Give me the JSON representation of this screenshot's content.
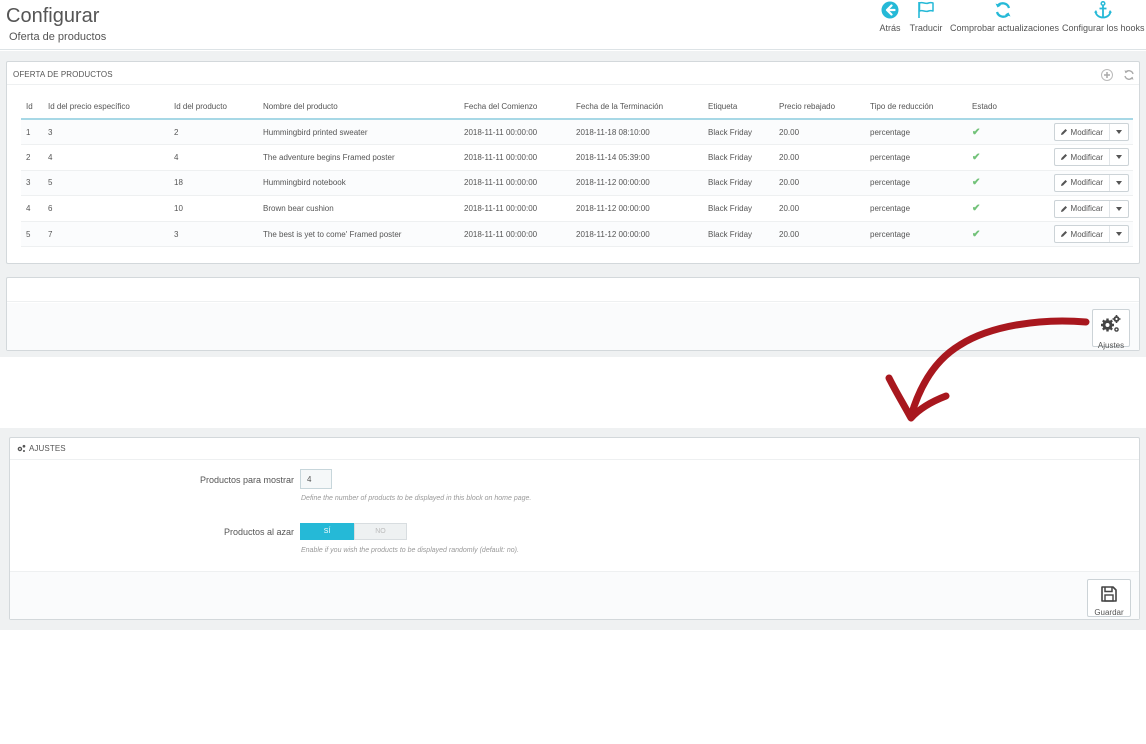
{
  "header": {
    "title": "Configurar",
    "subtitle": "Oferta de productos",
    "toolbar": [
      {
        "label": "Atrás",
        "icon": "arrow-left-circle-icon"
      },
      {
        "label": "Traducir",
        "icon": "flag-icon"
      },
      {
        "label": "Comprobar actualizaciones",
        "icon": "refresh-icon"
      },
      {
        "label": "Configurar los hooks",
        "icon": "anchor-icon"
      }
    ]
  },
  "offers_panel": {
    "title": "OFERTA DE PRODUCTOS",
    "columns": [
      "Id",
      "Id del precio específico",
      "Id del producto",
      "Nombre del producto",
      "Fecha del Comienzo",
      "Fecha de la Terminación",
      "Etiqueta",
      "Precio rebajado",
      "Tipo de reducción",
      "Estado"
    ],
    "rows": [
      {
        "id": "1",
        "price_id": "3",
        "product_id": "2",
        "name": "Hummingbird printed sweater",
        "start": "2018-11-11 00:00:00",
        "end": "2018-11-18 08:10:00",
        "label": "Black Friday",
        "price": "20.00",
        "type": "percentage"
      },
      {
        "id": "2",
        "price_id": "4",
        "product_id": "4",
        "name": "The adventure begins Framed poster",
        "start": "2018-11-11 00:00:00",
        "end": "2018-11-14 05:39:00",
        "label": "Black Friday",
        "price": "20.00",
        "type": "percentage"
      },
      {
        "id": "3",
        "price_id": "5",
        "product_id": "18",
        "name": "Hummingbird notebook",
        "start": "2018-11-11 00:00:00",
        "end": "2018-11-12 00:00:00",
        "label": "Black Friday",
        "price": "20.00",
        "type": "percentage"
      },
      {
        "id": "4",
        "price_id": "6",
        "product_id": "10",
        "name": "Brown bear cushion",
        "start": "2018-11-11 00:00:00",
        "end": "2018-11-12 00:00:00",
        "label": "Black Friday",
        "price": "20.00",
        "type": "percentage"
      },
      {
        "id": "5",
        "price_id": "7",
        "product_id": "3",
        "name": "The best is yet to come' Framed poster",
        "start": "2018-11-11 00:00:00",
        "end": "2018-11-12 00:00:00",
        "label": "Black Friday",
        "price": "20.00",
        "type": "percentage"
      }
    ],
    "edit_label": "Modificar"
  },
  "settings_button": {
    "label": "Ajustes"
  },
  "settings_panel": {
    "title": "AJUSTES",
    "products_label": "Productos para mostrar",
    "products_value": "4",
    "products_help": "Define the number of products to be displayed in this block on home page.",
    "random_label": "Productos al azar",
    "random_yes": "SÍ",
    "random_no": "NO",
    "random_value": "yes",
    "random_help": "Enable if you wish the products to be displayed randomly (default: no).",
    "save_label": "Guardar"
  },
  "colors": {
    "accent": "#25b9d7",
    "annotation_arrow": "#a8171e",
    "status_ok": "#72c279"
  }
}
